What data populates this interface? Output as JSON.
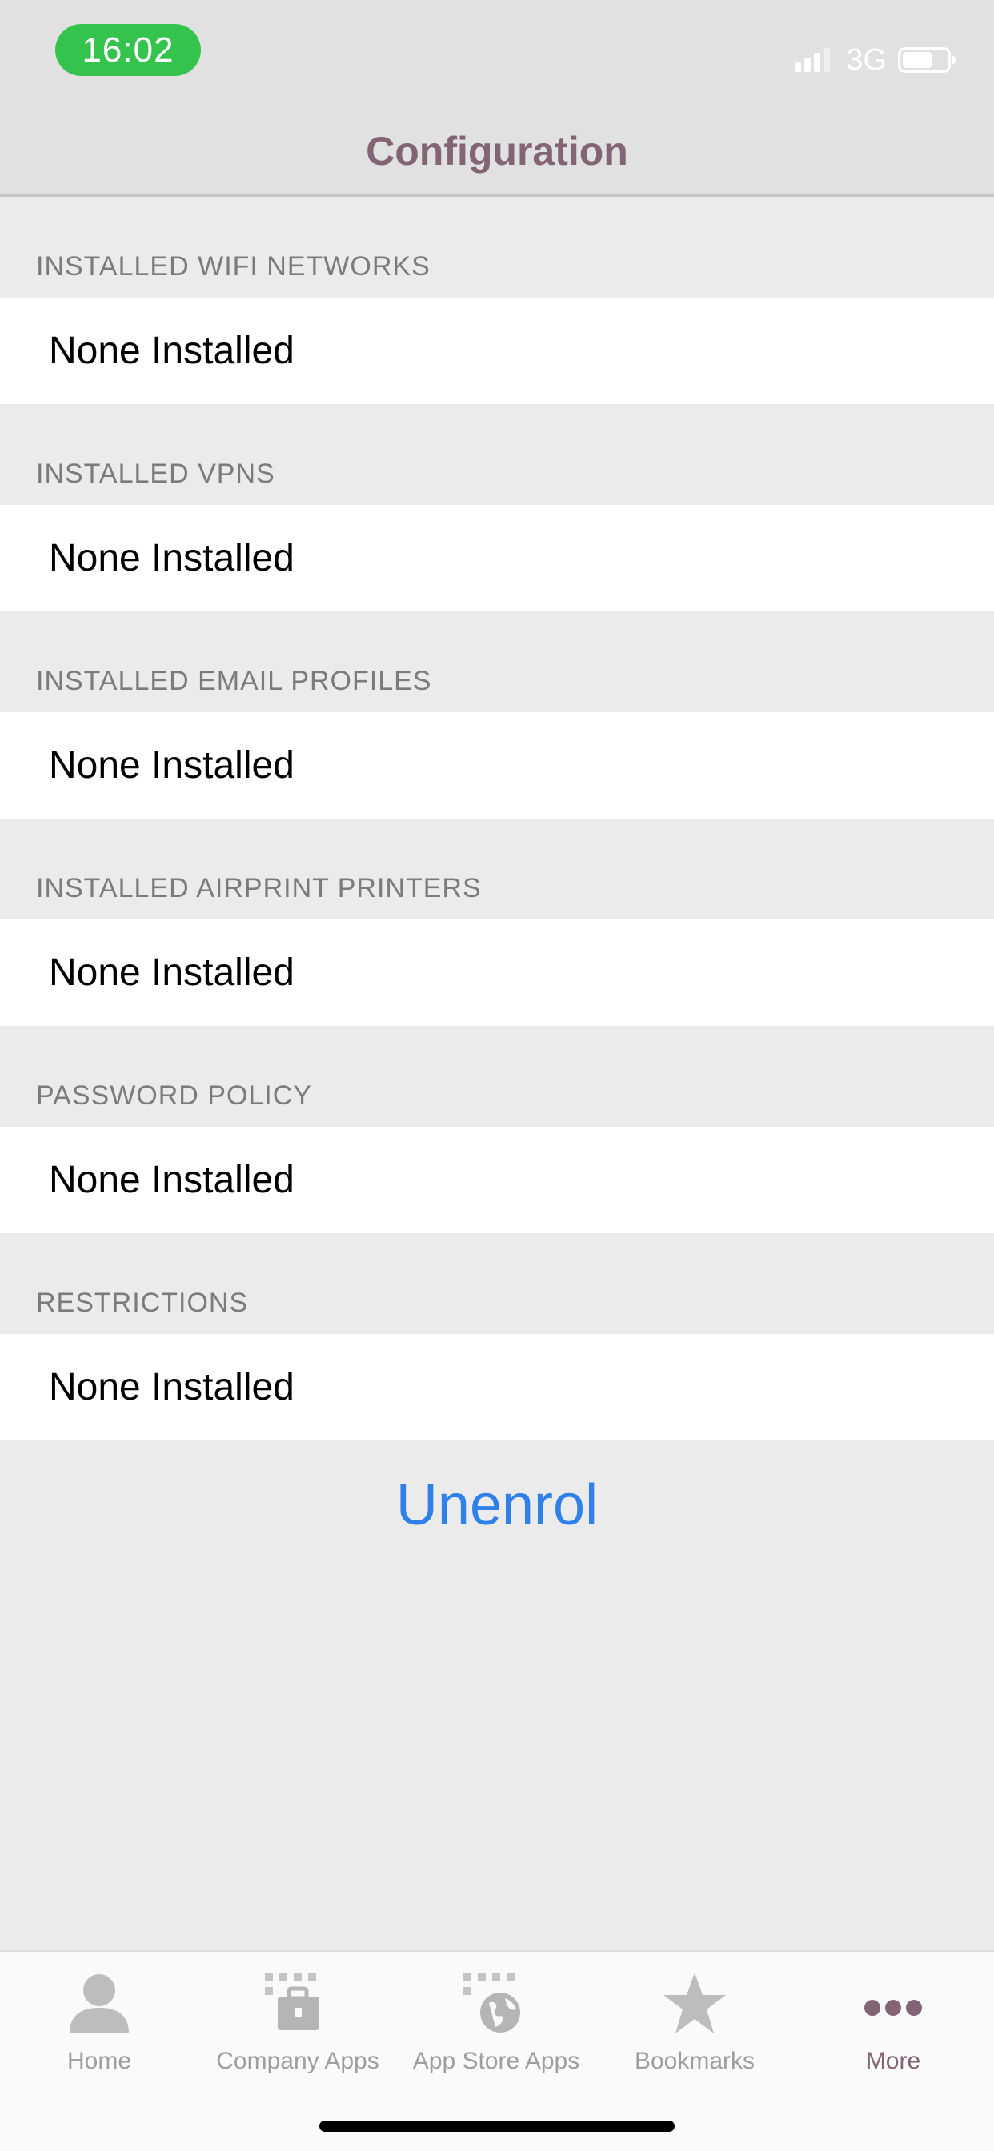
{
  "status_bar": {
    "time": "16:02",
    "network": "3G",
    "accent": "#34c44e"
  },
  "header": {
    "title": "Configuration",
    "title_color": "#836474"
  },
  "sections": [
    {
      "title": "INSTALLED WIFI NETWORKS",
      "value": "None Installed"
    },
    {
      "title": "INSTALLED VPNS",
      "value": "None Installed"
    },
    {
      "title": "INSTALLED EMAIL PROFILES",
      "value": "None Installed"
    },
    {
      "title": "INSTALLED AIRPRINT PRINTERS",
      "value": "None Installed"
    },
    {
      "title": "PASSWORD POLICY",
      "value": "None Installed"
    },
    {
      "title": "RESTRICTIONS",
      "value": "None Installed"
    }
  ],
  "actions": {
    "unenrol_label": "Unenrol",
    "unenrol_color": "#2f80e8"
  },
  "tabbar": {
    "items": [
      {
        "label": "Home",
        "icon": "person-icon",
        "active": false
      },
      {
        "label": "Company Apps",
        "icon": "briefcase-icon",
        "active": false
      },
      {
        "label": "App Store Apps",
        "icon": "globe-icon",
        "active": false
      },
      {
        "label": "Bookmarks",
        "icon": "star-icon",
        "active": false
      },
      {
        "label": "More",
        "icon": "more-dots-icon",
        "active": true
      }
    ],
    "inactive_color": "#9e9e9e",
    "active_color": "#836474"
  }
}
